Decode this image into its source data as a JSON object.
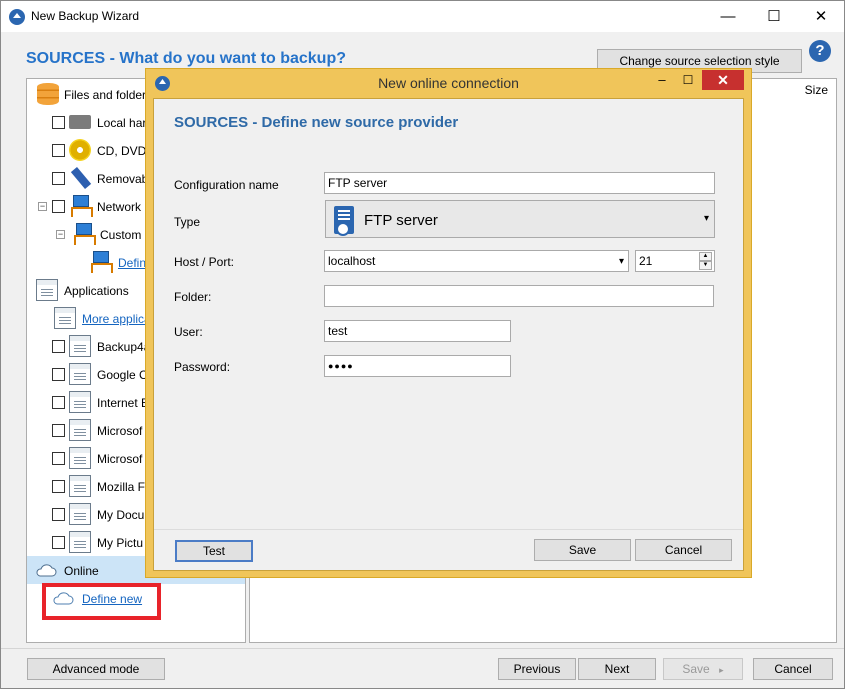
{
  "window": {
    "title": "New Backup Wizard",
    "minimize": "—",
    "maximize": "☐",
    "close": "✕"
  },
  "page": {
    "heading": "SOURCES - What do you want to backup?",
    "change_style_label": "Change source selection style",
    "help": "?"
  },
  "tree": {
    "files_label": "Files and folders",
    "local_label": "Local hard",
    "cd_label": "CD, DVD",
    "removable_label": "Removab",
    "network_label": "Network",
    "custom_label": "Custom",
    "define_net_label": "Define",
    "applications_label": "Applications",
    "more_apps_label": "More applica",
    "apps": [
      "Backup4a",
      "Google C",
      "Internet E",
      "Microsof",
      "Microsof",
      "Mozilla F",
      "My Docu",
      "My Pictu"
    ],
    "online_label": "Online",
    "define_new_label": "Define new"
  },
  "list": {
    "size_header": "Size"
  },
  "bottom": {
    "advanced": "Advanced mode",
    "previous": "Previous",
    "next": "Next",
    "save": "Save",
    "cancel": "Cancel"
  },
  "dialog": {
    "title": "New online connection",
    "heading": "SOURCES - Define new source provider",
    "labels": {
      "config_name": "Configuration name",
      "type": "Type",
      "host_port": "Host / Port:",
      "folder": "Folder:",
      "user": "User:",
      "password": "Password:"
    },
    "values": {
      "config_name": "FTP server",
      "type": "FTP server",
      "host": "localhost",
      "port": "21",
      "folder": "",
      "user": "test",
      "password": "●●●●"
    },
    "buttons": {
      "test": "Test",
      "save": "Save",
      "cancel": "Cancel"
    }
  }
}
